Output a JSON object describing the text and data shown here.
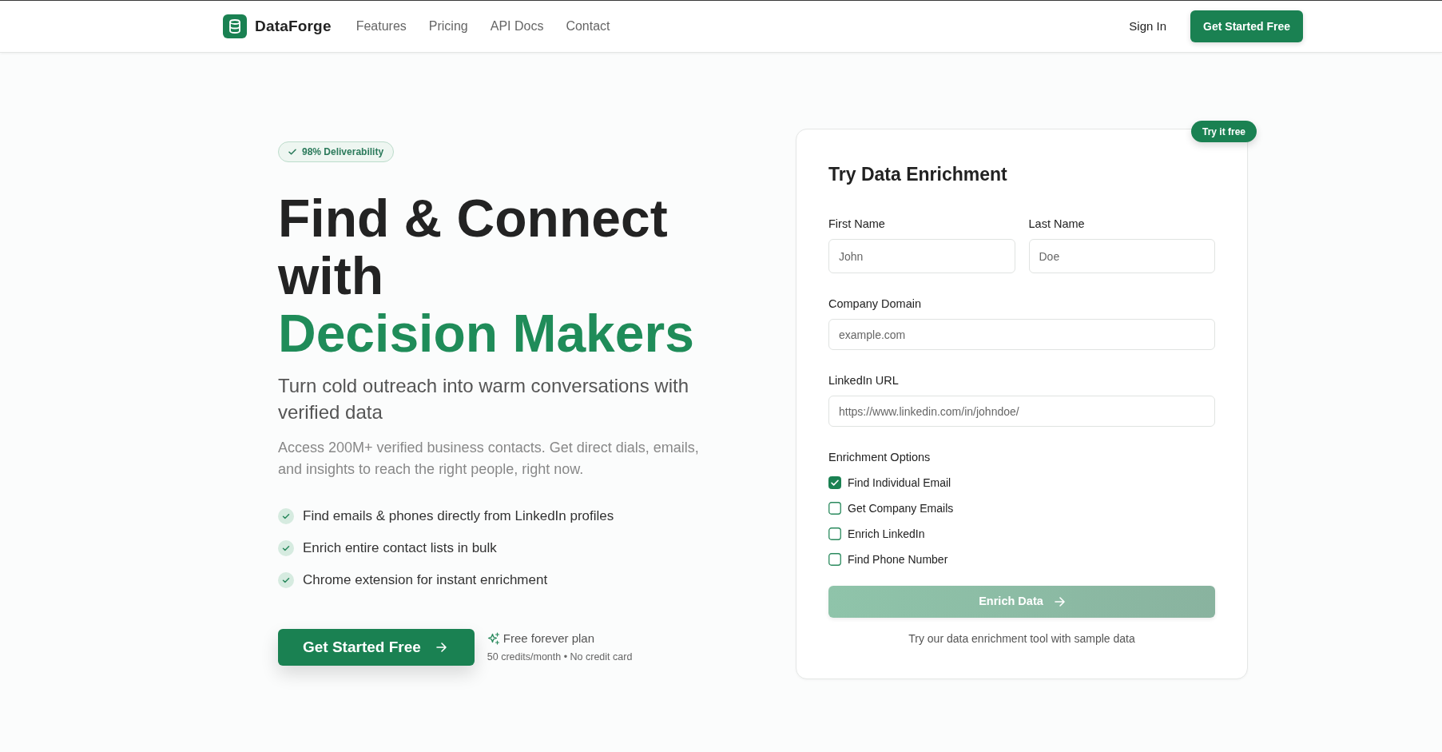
{
  "nav": {
    "brand": "DataForge",
    "links": [
      "Features",
      "Pricing",
      "API Docs",
      "Contact"
    ],
    "sign_in": "Sign In",
    "cta": "Get Started Free"
  },
  "hero": {
    "badge": "98% Deliverability",
    "headline": "Find & Connect with",
    "headline_highlight": "Decision Makers",
    "subtitle": "Turn cold outreach into warm conversations with verified data",
    "description": "Access 200M+ verified business contacts. Get direct dials, emails, and insights to reach the right people, right now.",
    "features": [
      "Find emails & phones directly from LinkedIn profiles",
      "Enrich entire contact lists in bulk",
      "Chrome extension for instant enrichment"
    ],
    "cta": "Get Started Free",
    "plan": {
      "title": "Free forever plan",
      "note": "50 credits/month • No credit card"
    }
  },
  "enrichment_form": {
    "tag": "Try it free",
    "title": "Try Data Enrichment",
    "fields": [
      {
        "label": "First Name",
        "placeholder": "John"
      },
      {
        "label": "Last Name",
        "placeholder": "Doe"
      },
      {
        "label": "Company Domain",
        "placeholder": "example.com"
      },
      {
        "label": "LinkedIn URL",
        "placeholder": "https://www.linkedin.com/in/johndoe/"
      }
    ],
    "options_label": "Enrichment Options",
    "options": [
      {
        "label": "Find Individual Email",
        "checked": true
      },
      {
        "label": "Get Company Emails",
        "checked": false
      },
      {
        "label": "Enrich LinkedIn",
        "checked": false
      },
      {
        "label": "Find Phone Number",
        "checked": false
      }
    ],
    "submit": {
      "label": "Enrich Data",
      "disabled": true
    },
    "note": "Try our data enrichment tool with sample data"
  }
}
